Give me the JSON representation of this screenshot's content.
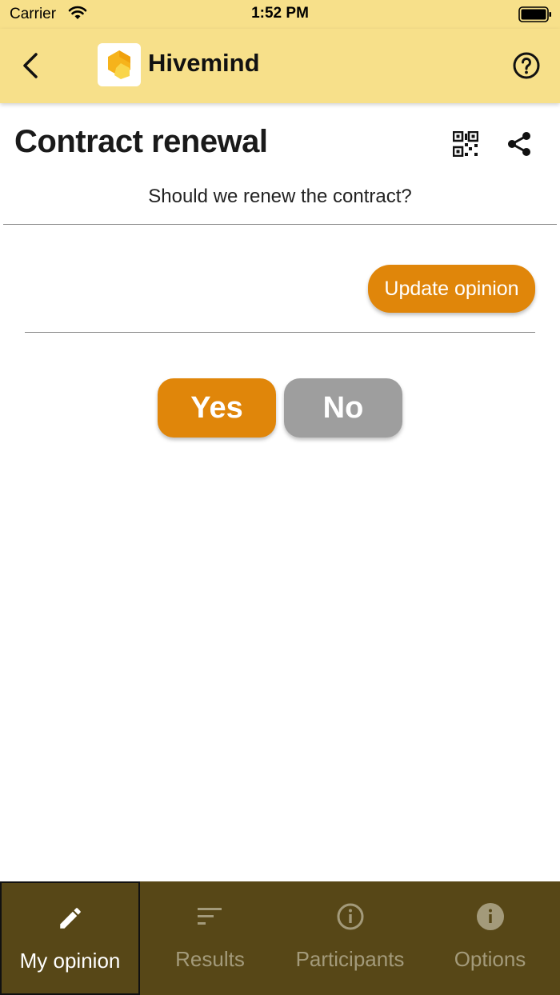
{
  "status_bar": {
    "carrier": "Carrier",
    "time": "1:52 PM"
  },
  "app_bar": {
    "title": "Hivemind",
    "back_icon": "chevron-left-icon",
    "help_icon": "help-circle-icon"
  },
  "poll": {
    "title": "Contract renewal",
    "question": "Should we renew the contract?"
  },
  "actions": {
    "update_label": "Update opinion",
    "yes_label": "Yes",
    "no_label": "No"
  },
  "tabs": [
    {
      "label": "My opinion",
      "icon": "pencil-icon",
      "active": true
    },
    {
      "label": "Results",
      "icon": "sort-lines-icon",
      "active": false
    },
    {
      "label": "Participants",
      "icon": "info-outline-icon",
      "active": false
    },
    {
      "label": "Options",
      "icon": "info-filled-icon",
      "active": false
    }
  ],
  "colors": {
    "appbar": "#f7e08a",
    "accent": "#e0860a",
    "inactive": "#9e9e9e",
    "bottombar": "#574717"
  }
}
